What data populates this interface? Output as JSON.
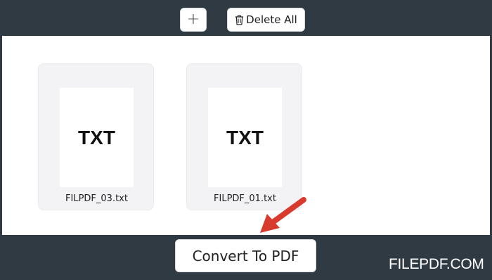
{
  "toolbar": {
    "add_label": "+",
    "delete_all_label": "Delete All",
    "delete_icon": "trash-icon"
  },
  "files": [
    {
      "type_label": "TXT",
      "name": "FILPDF_03.txt"
    },
    {
      "type_label": "TXT",
      "name": "FILPDF_01.txt"
    }
  ],
  "action": {
    "convert_label": "Convert To PDF",
    "pointer_icon": "arrow-pointer-icon",
    "pointer_color": "#d83a2e"
  },
  "watermark": "FILEPDF.COM",
  "colors": {
    "frame": "#2f3a43",
    "card": "#f3f3f5",
    "button": "#ffffff"
  }
}
